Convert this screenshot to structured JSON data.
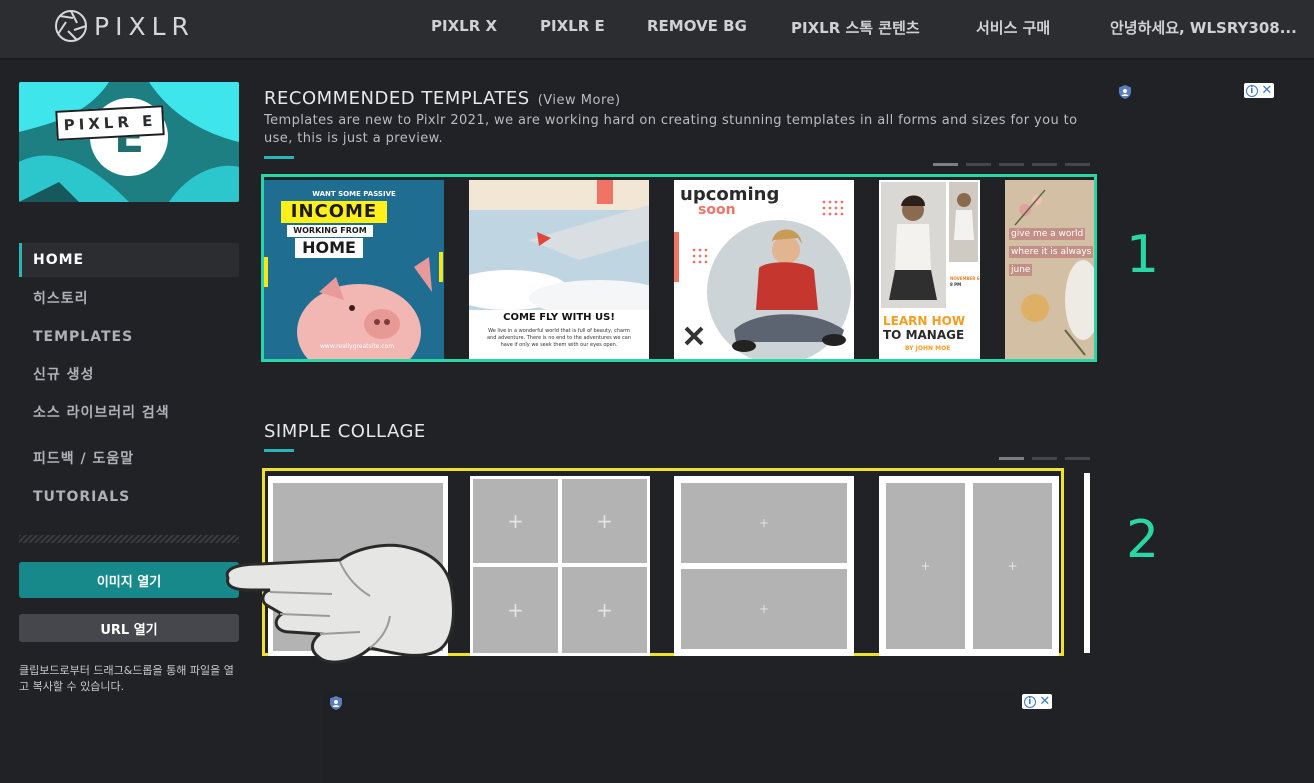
{
  "header": {
    "logo_text": "PIXLR",
    "nav": [
      "PIXLR X",
      "PIXLR E",
      "REMOVE BG",
      "PIXLR 스톡 콘텐츠",
      "서비스 구매",
      "안녕하세요, WLSRY308..."
    ]
  },
  "sidebar": {
    "app_letter": "E",
    "app_label": "PIXLR E",
    "menu": [
      "HOME",
      "히스토리",
      "TEMPLATES",
      "신규 생성",
      "소스 라이브러리 검색",
      "피드백 / 도움말",
      "TUTORIALS"
    ],
    "open_image_label": "이미지 열기",
    "open_url_label": "URL 열기",
    "drop_hint": "클립보드로부터 드래그&드롭을 통해 파일을 열고 복사할 수 있습니다."
  },
  "templates": {
    "title": "RECOMMENDED TEMPLATES",
    "view_more": "(View More)",
    "description": "Templates are new to Pixlr 2021, we are working hard on creating stunning templates in all forms and sizes for you to use, this is just a preview.",
    "items": [
      {
        "want": "WANT SOME PASSIVE",
        "income": "INCOME",
        "working": "WORKING FROM",
        "home": "HOME",
        "url": "www.reallygreatsite.com"
      },
      {
        "title": "COME FLY WITH US!",
        "body": "We live in a wonderful world that is full of beauty, charm and adventure. There is no end to the adventures we can have if only we seek them with our eyes open."
      },
      {
        "title": "upcoming",
        "subtitle": "soon"
      },
      {
        "learn": "LEARN HOW",
        "manage": "TO MANAGE",
        "by": "BY JOHN MOE",
        "date": "NOVEMBER 6",
        "time": "8 PM"
      },
      {
        "line1": "give me a world",
        "line2": "where it is always",
        "line3": "june"
      }
    ]
  },
  "collage": {
    "title": "SIMPLE COLLAGE",
    "plus": "+"
  },
  "annotations": [
    "1",
    "2"
  ],
  "colors": {
    "accent": "#2bb5b8",
    "box_templates": "#2bd6a6",
    "box_collage": "#f0e22a",
    "open_button": "#17898b"
  }
}
